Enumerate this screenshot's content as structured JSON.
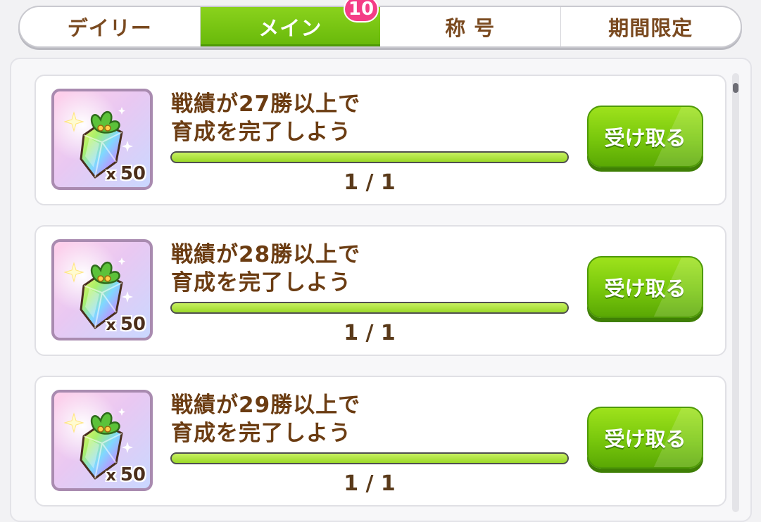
{
  "tabs": [
    {
      "label": "デイリー",
      "active": false
    },
    {
      "label": "メイン",
      "active": true,
      "badge": "10"
    },
    {
      "label": "称 号",
      "active": false
    },
    {
      "label": "期間限定",
      "active": false
    }
  ],
  "missions": [
    {
      "title_line1": "戦績が27勝以上で",
      "title_line2": "育成を完了しよう",
      "progress_text": "1 / 1",
      "progress_fraction": 1.0,
      "reward_icon": "rainbow-crystal-icon",
      "reward_qty_prefix": "x",
      "reward_qty": "50",
      "claim_label": "受け取る"
    },
    {
      "title_line1": "戦績が28勝以上で",
      "title_line2": "育成を完了しよう",
      "progress_text": "1 / 1",
      "progress_fraction": 1.0,
      "reward_icon": "rainbow-crystal-icon",
      "reward_qty_prefix": "x",
      "reward_qty": "50",
      "claim_label": "受け取る"
    },
    {
      "title_line1": "戦績が29勝以上で",
      "title_line2": "育成を完了しよう",
      "progress_text": "1 / 1",
      "progress_fraction": 1.0,
      "reward_icon": "rainbow-crystal-icon",
      "reward_qty_prefix": "x",
      "reward_qty": "50",
      "claim_label": "受け取る"
    }
  ],
  "colors": {
    "accent_green": "#78c70c",
    "text_brown": "#6b3c12",
    "badge_pink": "#f43d86"
  }
}
